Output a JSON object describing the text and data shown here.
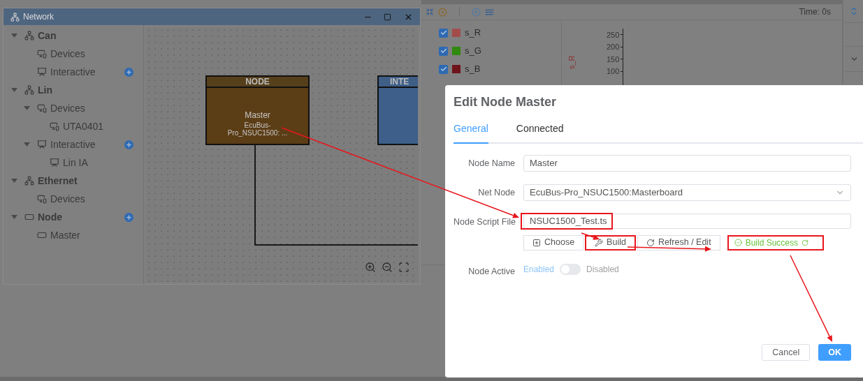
{
  "network": {
    "title": "Network",
    "tree": [
      {
        "label": "Can",
        "kind": "bus",
        "expanded": true,
        "add_button": false,
        "children": [
          {
            "label": "Devices",
            "kind": "devices",
            "add_button": false
          },
          {
            "label": "Interactive",
            "kind": "interactive",
            "add_button": true
          }
        ]
      },
      {
        "label": "Lin",
        "kind": "bus",
        "expanded": true,
        "add_button": false,
        "children": [
          {
            "label": "Devices",
            "kind": "devices",
            "expanded": true,
            "add_button": false,
            "children": [
              {
                "label": "UTA0401",
                "kind": "devices",
                "add_button": false
              }
            ]
          },
          {
            "label": "Interactive",
            "kind": "interactive",
            "expanded": true,
            "add_button": true,
            "children": [
              {
                "label": "Lin IA",
                "kind": "interactive",
                "add_button": false
              }
            ]
          }
        ]
      },
      {
        "label": "Ethernet",
        "kind": "bus",
        "expanded": true,
        "add_button": false,
        "children": [
          {
            "label": "Devices",
            "kind": "devices",
            "add_button": false
          }
        ]
      },
      {
        "label": "Node",
        "kind": "node",
        "expanded": true,
        "add_button": true,
        "children": [
          {
            "label": "Master",
            "kind": "node",
            "add_button": false
          }
        ]
      }
    ],
    "canvas": {
      "nodes": [
        {
          "kind": "node",
          "header": "NODE",
          "title": "Master",
          "subtitle": "EcuBus-Pro_NSUC1500: ..."
        },
        {
          "kind": "interactive",
          "header": "INTE"
        }
      ]
    }
  },
  "graph": {
    "time": "Time: 0s",
    "signals": [
      {
        "name": "s_R",
        "checked": true,
        "color": "#a24c4a"
      },
      {
        "name": "s_G",
        "checked": true,
        "color": "#2f8a0e"
      },
      {
        "name": "s_B",
        "checked": true,
        "color": "#6e141a"
      }
    ],
    "axis": {
      "label": "s_R",
      "ticks": [
        "250",
        "200",
        "150",
        "100"
      ]
    }
  },
  "dialog": {
    "title": "Edit Node Master",
    "tabs": [
      {
        "label": "General",
        "selected": true
      },
      {
        "label": "Connected",
        "selected": false
      }
    ],
    "fields": [
      {
        "kind": "text",
        "label": "Node Name",
        "value": "Master"
      },
      {
        "kind": "select",
        "label": "Net Node",
        "value": "EcuBus-Pro_NSUC1500:Masterboard"
      },
      {
        "kind": "file",
        "label": "Node Script File",
        "value": "NSUC1500_Test.ts",
        "highlighted": true,
        "actions": [
          {
            "kind": "choose",
            "label": "Choose",
            "highlighted": false
          },
          {
            "kind": "build",
            "label": "Build",
            "highlighted": true
          },
          {
            "kind": "refresh",
            "label": "Refresh / Edit",
            "highlighted": false
          }
        ],
        "status": {
          "text": "Build Success",
          "highlighted": true
        }
      },
      {
        "kind": "switch",
        "label": "Node Active",
        "active_text": "Enabled",
        "inactive_text": "Disabled",
        "on": false
      }
    ],
    "buttons": [
      {
        "label": "Cancel",
        "primary": false
      },
      {
        "label": "OK",
        "primary": true
      }
    ]
  }
}
